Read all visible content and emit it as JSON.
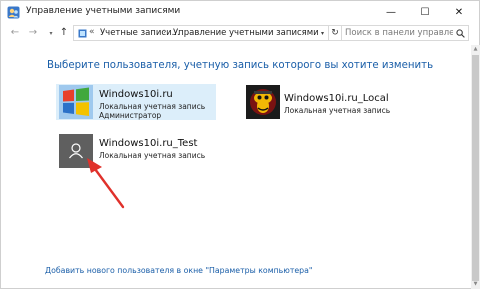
{
  "window": {
    "title": "Управление учетными записями",
    "minimize_glyph": "—",
    "maximize_glyph": "☐",
    "close_glyph": "✕",
    "icon": "user-accounts-icon"
  },
  "navbar": {
    "back_glyph": "←",
    "forward_glyph": "→",
    "recent_glyph": "▾",
    "up_glyph": "↑",
    "separator_glyph": "«",
    "crumb_arrow": "›",
    "breadcrumbs": [
      "Учетные записи...",
      "Управление учетными записями"
    ],
    "dropdown_glyph": "▾",
    "refresh_glyph": "↻",
    "search_placeholder": "Поиск в панели управления"
  },
  "main": {
    "heading": "Выберите пользователя, учетную запись которого вы хотите изменить",
    "accounts": [
      {
        "name": "Windows10i.ru",
        "type": "Локальная учетная запись",
        "role": "Администратор",
        "selected": true,
        "avatar": "windows-logo-avatar"
      },
      {
        "name": "Windows10i.ru_Local",
        "type": "Локальная учетная запись",
        "role": "",
        "selected": false,
        "avatar": "cartoon-avatar"
      },
      {
        "name": "Windows10i.ru_Test",
        "type": "Локальная учетная запись",
        "role": "",
        "selected": false,
        "avatar": "default-user-avatar"
      }
    ],
    "add_user_link": "Добавить нового пользователя в окне \"Параметры компьютера\""
  },
  "scrollbar": {
    "up_glyph": "▲",
    "down_glyph": "▼"
  },
  "colors": {
    "accent_link": "#1a5ea8",
    "selection_bg": "#dceefa",
    "annotation_arrow": "#e0312b"
  }
}
